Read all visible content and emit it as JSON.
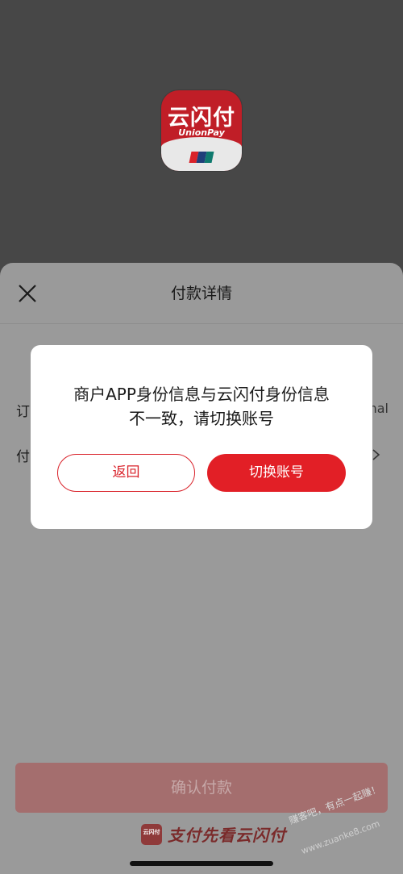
{
  "app_logo": {
    "name_cn": "云闪付",
    "name_en": "UnionPay",
    "colors": {
      "red": "#c01e27",
      "card_red": "#d9222a",
      "card_blue": "#1f3f7a",
      "card_green": "#0f7a6e"
    }
  },
  "sheet": {
    "title": "付款详情",
    "close_icon": "close-icon",
    "rows": [
      {
        "label": "订",
        "value": "nal"
      },
      {
        "label": "付",
        "icon": "chevron-right-icon"
      }
    ],
    "confirm_label": "确认付款",
    "footer_logo_text": "云闪付",
    "footer_slogan": "支付先看云闪付"
  },
  "dialog": {
    "message_line1": "商户APP身份信息与云闪付身份信息",
    "message_line2": "不一致，请切换账号",
    "back_label": "返回",
    "switch_label": "切换账号"
  },
  "watermark": {
    "text": "赚客吧，有点一起赚！",
    "url": "www.zuanke8.com"
  },
  "colors": {
    "accent": "#e21f26",
    "overlay_top": "#474747",
    "overlay_sheet": "#9a9a9a"
  }
}
